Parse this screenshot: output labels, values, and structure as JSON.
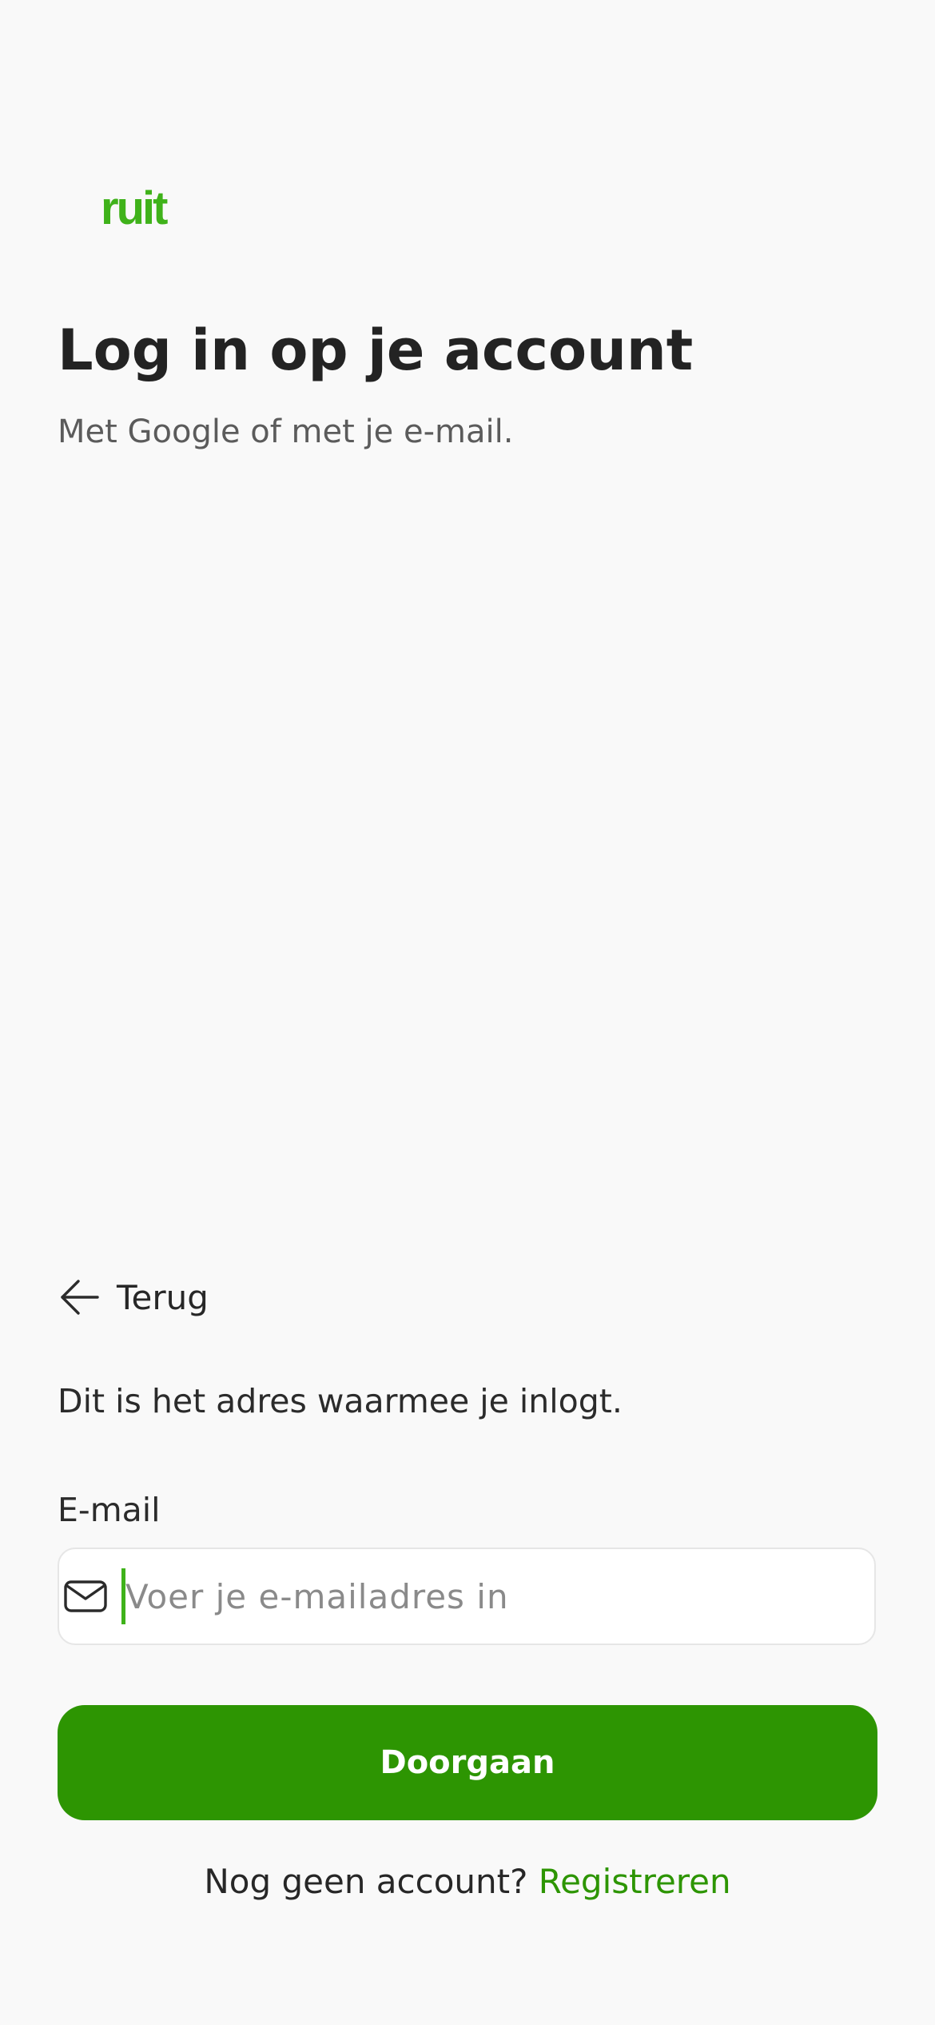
{
  "brand": {
    "logo_text": "ruit",
    "accent_color": "#3fb21a",
    "button_color": "#2d9502"
  },
  "header": {
    "title": "Log in op je account",
    "subtitle": "Met Google of met je e-mail."
  },
  "form": {
    "back_label": "Terug",
    "helper_text": "Dit is het adres waarmee je inlogt.",
    "email_label": "E-mail",
    "email_value": "",
    "email_placeholder": "Voer je e-mailadres in",
    "email_icon": "envelope-icon",
    "back_icon": "arrow-left-icon",
    "submit_label": "Doorgaan"
  },
  "footer": {
    "prompt": "Nog geen account?",
    "signup_link": "Registreren"
  }
}
